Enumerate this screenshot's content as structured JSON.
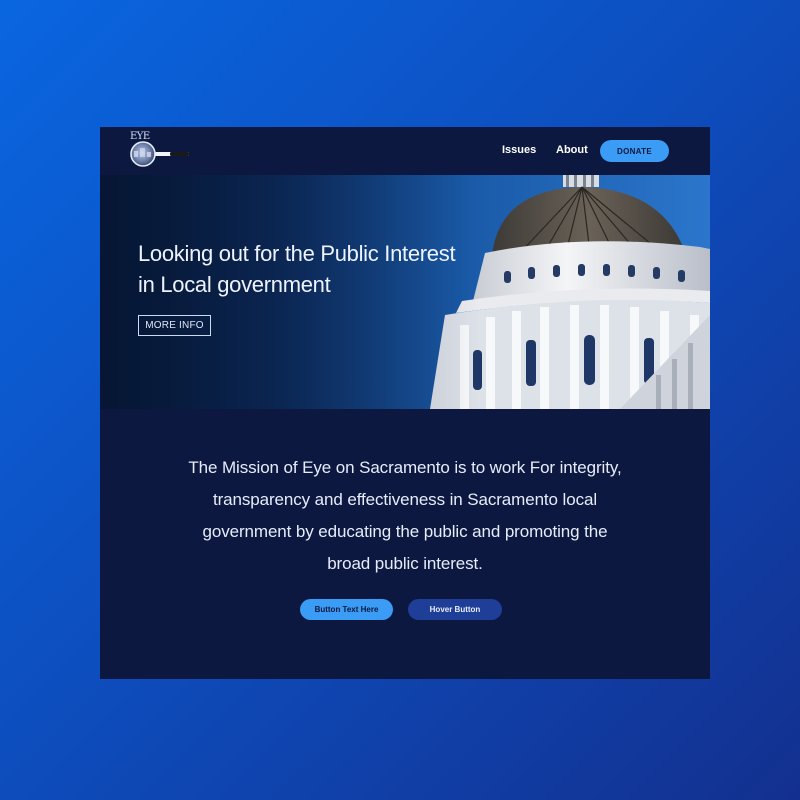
{
  "logo": {
    "text": "EYE"
  },
  "nav": {
    "items": [
      {
        "label": "Issues"
      },
      {
        "label": "About"
      }
    ],
    "donate_label": "DONATE"
  },
  "hero": {
    "title": "Looking out for the Public Interest in Local government",
    "cta_label": "MORE INFO"
  },
  "mission": {
    "text": "The Mission of Eye on Sacramento is to work For integrity, transparency and effectiveness in Sacramento local government by educating the public and promoting the broad public interest."
  },
  "buttons": {
    "primary_label": "Button Text Here",
    "hover_label": "Hover Button"
  },
  "colors": {
    "background_gradient_start": "#0a66e0",
    "background_gradient_end": "#13308f",
    "panel": "#0c1840",
    "accent": "#3a9cf5",
    "hover_button": "#1e3e98"
  }
}
